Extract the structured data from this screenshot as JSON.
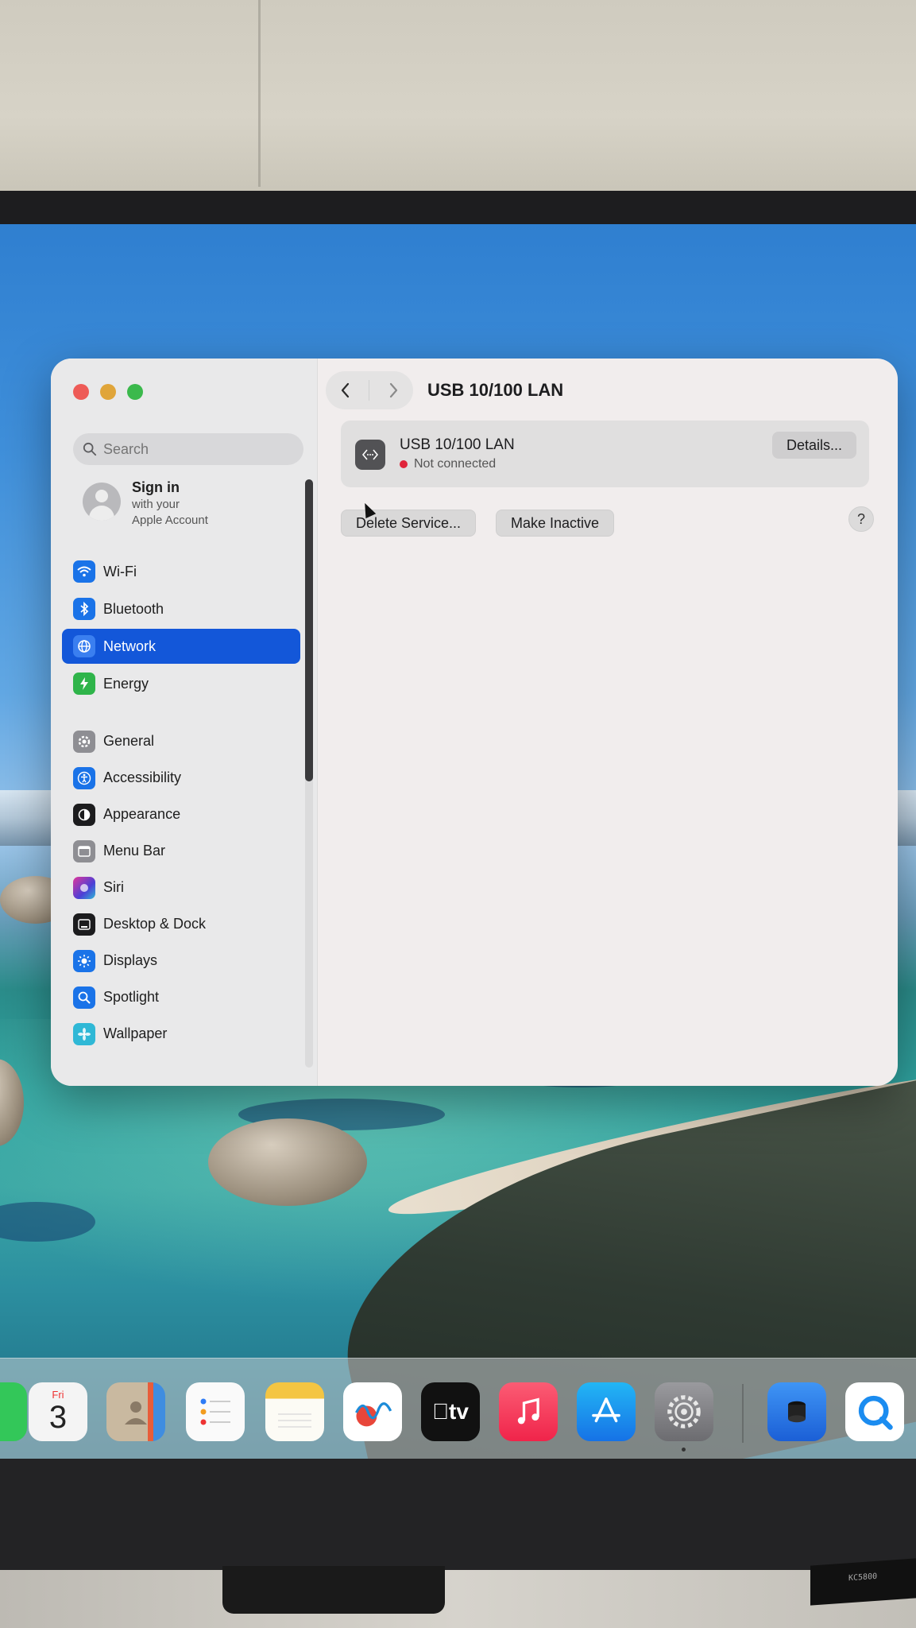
{
  "window": {
    "title": "USB 10/100 LAN",
    "nav_back": "back",
    "nav_forward": "forward"
  },
  "sidebar": {
    "search_placeholder": "Search",
    "account": {
      "title": "Sign in",
      "line1": "with your",
      "line2": "Apple Account"
    },
    "group1": [
      {
        "label": "Wi-Fi",
        "icon": "wifi-icon",
        "color": "#1a73e8"
      },
      {
        "label": "Bluetooth",
        "icon": "bluetooth-icon",
        "color": "#1a73e8"
      },
      {
        "label": "Network",
        "icon": "globe-icon",
        "color": "#1a73e8",
        "selected": true
      },
      {
        "label": "Energy",
        "icon": "bolt-icon",
        "color": "#2fb44a"
      }
    ],
    "group2": [
      {
        "label": "General",
        "icon": "gear-icon",
        "color": "#8e8e93"
      },
      {
        "label": "Accessibility",
        "icon": "accessibility-icon",
        "color": "#1a73e8"
      },
      {
        "label": "Appearance",
        "icon": "appearance-icon",
        "color": "#1c1c1e"
      },
      {
        "label": "Menu Bar",
        "icon": "menubar-icon",
        "color": "#8e8e93"
      },
      {
        "label": "Siri",
        "icon": "siri-icon",
        "color": "#6b3fd6"
      },
      {
        "label": "Desktop & Dock",
        "icon": "dock-icon",
        "color": "#1c1c1e"
      },
      {
        "label": "Displays",
        "icon": "sun-icon",
        "color": "#1a73e8"
      },
      {
        "label": "Spotlight",
        "icon": "magnifier-icon",
        "color": "#1a73e8"
      },
      {
        "label": "Wallpaper",
        "icon": "flower-icon",
        "color": "#2fb8d6"
      }
    ]
  },
  "service": {
    "name": "USB 10/100 LAN",
    "status": "Not connected",
    "status_color": "#e0243a",
    "details_button": "Details..."
  },
  "actions": {
    "delete_service": "Delete Service...",
    "make_inactive": "Make Inactive",
    "help": "?"
  },
  "dock": {
    "calendar_day": "Fri",
    "calendar_date": "3",
    "tv_label": "tv"
  },
  "monitor_tag": "KC5800"
}
